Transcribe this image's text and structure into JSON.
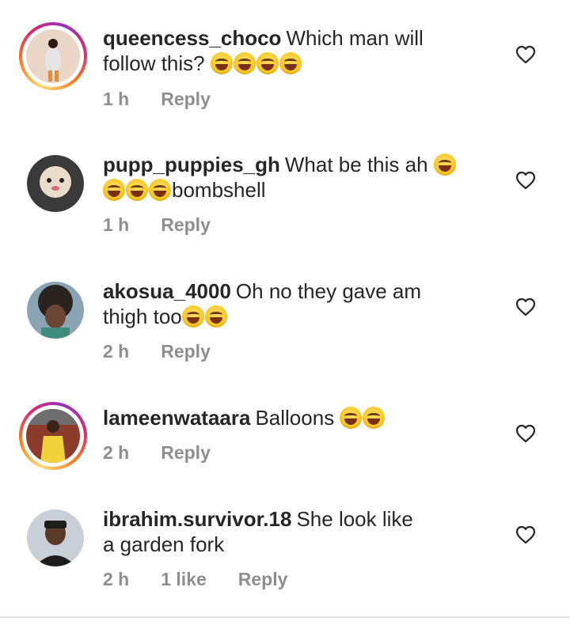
{
  "comments": [
    {
      "username": "queencess_choco",
      "text_line1": "Which man will",
      "text_line2": "follow this?",
      "emoji_after_line2": 4,
      "time": "1 h",
      "reply": "Reply",
      "has_story_ring": true,
      "emoji_icon": "tears-of-joy-emoji"
    },
    {
      "username": "pupp_puppies_gh",
      "text_line1": "What be this ah",
      "text_line2": "bombshell",
      "time": "1 h",
      "reply": "Reply",
      "has_story_ring": false,
      "emoji_icon": "tears-of-joy-emoji"
    },
    {
      "username": "akosua_4000",
      "text_line1": "Oh no they gave am",
      "text_line2": "thigh too",
      "time": "2 h",
      "reply": "Reply",
      "has_story_ring": false,
      "emoji_icon": "laughing-squint-emoji"
    },
    {
      "username": "lameenwataara",
      "text_line1": "Balloons",
      "time": "2 h",
      "reply": "Reply",
      "has_story_ring": true,
      "emoji_icon": "tears-of-joy-emoji"
    },
    {
      "username": "ibrahim.survivor.18",
      "text_line1": "She look like",
      "text_line2": "a garden fork",
      "time": "2 h",
      "likes": "1 like",
      "reply": "Reply",
      "has_story_ring": false
    }
  ],
  "icons": {
    "like": "heart-outline-icon"
  },
  "colors": {
    "text": "#262626",
    "meta": "#8e8e8e",
    "story_ring": [
      "#feda75",
      "#fa7e1e",
      "#d62976",
      "#962fbf"
    ]
  }
}
